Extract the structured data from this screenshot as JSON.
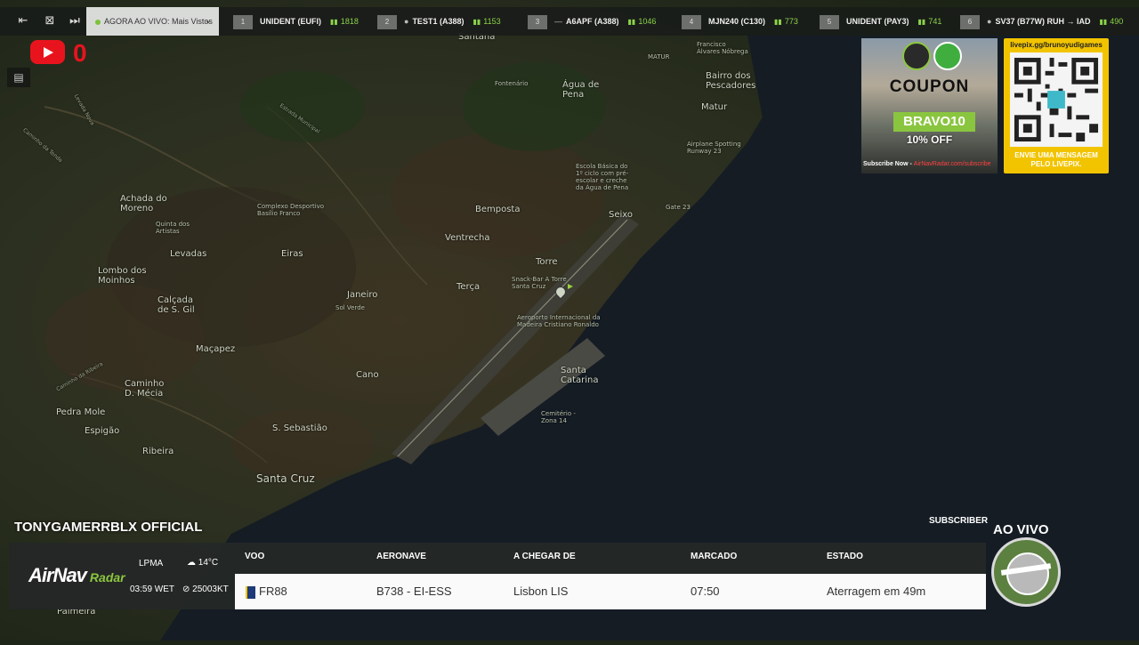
{
  "topbar": {
    "live_select": "AGORA AO VIVO: Mais Vistos",
    "flights": [
      {
        "rank": "1",
        "code": "UNIDENT (EUFI)",
        "count": "1818"
      },
      {
        "rank": "2",
        "code": "TEST1 (A388)",
        "count": "1153"
      },
      {
        "rank": "3",
        "code": "A6APF (A388)",
        "count": "1046"
      },
      {
        "rank": "4",
        "code": "MJN240 (C130)",
        "count": "773"
      },
      {
        "rank": "5",
        "code": "UNIDENT (PAY3)",
        "count": "741"
      },
      {
        "rank": "6",
        "code": "SV37 (B77W)  RUH → IAD",
        "count": "490"
      }
    ]
  },
  "youtube": {
    "count": "0"
  },
  "map_labels": {
    "santana": "Santana",
    "matur_top": "MATUR",
    "francisco": "Francisco Álvares Nóbrega",
    "bairro": "Bairro dos Pescadores",
    "matur": "Matur",
    "agua_pena": "Água de Pena",
    "fontenario": "Fontenário",
    "escola": "Escola Básica do 1º ciclo com pré-escolar e creche da Água de Pena",
    "airplane_spotting": "Airplane Spotting Runway 23",
    "gate": "Gate 23",
    "seixo": "Seixo",
    "bemposta": "Bemposta",
    "ventrecha": "Ventrecha",
    "torre": "Torre",
    "terca": "Terça",
    "snack": "Snack-Bar A Torre Santa Cruz",
    "achada": "Achada do Moreno",
    "complexo": "Complexo Desportivo Basílio Franco",
    "quinta": "Quinta dos Artistas",
    "eiras": "Eiras",
    "levadas": "Levadas",
    "lombo": "Lombo dos Moinhos",
    "janeiro": "Janeiro",
    "sol_verde": "Sol Verde",
    "calcada": "Calçada de S. Gil",
    "aeroporto": "Aeroporto Internacional da Madeira Cristiano Ronaldo",
    "macapez": "Maçapez",
    "cano": "Cano",
    "santa_catarina": "Santa Catarina",
    "cemiterio": "Cemitério - Zona 14",
    "caminho": "Caminho D. Mécia",
    "pedra": "Pedra Mole",
    "espigao": "Espigão",
    "s_sebastiao": "S. Sebastião",
    "ribeira": "Ribeira",
    "ribeira_road": "Caminho da Ribeira",
    "santa_cruz": "Santa Cruz",
    "levada": "Levada Nova",
    "camino": "Caminho da Tenda",
    "palmeira": "Palmeira",
    "estrada": "Estrada Municipal"
  },
  "coupon": {
    "title": "COUPON",
    "code": "BRAVO10",
    "off": "10% OFF",
    "site_prefix": "Subscribe Now - ",
    "site": "AirNavRadar.com/subscribe"
  },
  "qr": {
    "url": "livepix.gg/brunoyudigames",
    "caption_line1": "ENVIE UMA MENSAGEM",
    "caption_line2": "PELO LIVEPIX."
  },
  "channel": {
    "name": "TONYGAMERRBLX OFFICIAL",
    "subscribe": "SUBSCRIBER",
    "live": "AO VIVO"
  },
  "infobar": {
    "logo_main": "AirNav",
    "logo_sub": "Radar",
    "airport": "LPMA",
    "time": "03:59 WET",
    "temperature": "14°C",
    "wind": "25003KT",
    "headers": {
      "voo": "VOO",
      "aeronave": "AERONAVE",
      "origem": "A CHEGAR DE",
      "marcado": "MARCADO",
      "estado": "ESTADO"
    },
    "row": {
      "voo": "FR88",
      "aeronave": "B738 - EI-ESS",
      "origem": "Lisbon LIS",
      "marcado": "07:50",
      "estado": "Aterragem em 49m"
    }
  },
  "colors": {
    "accent_green": "#8cc63f",
    "youtube_red": "#e8141d",
    "qr_yellow": "#f2c400"
  }
}
